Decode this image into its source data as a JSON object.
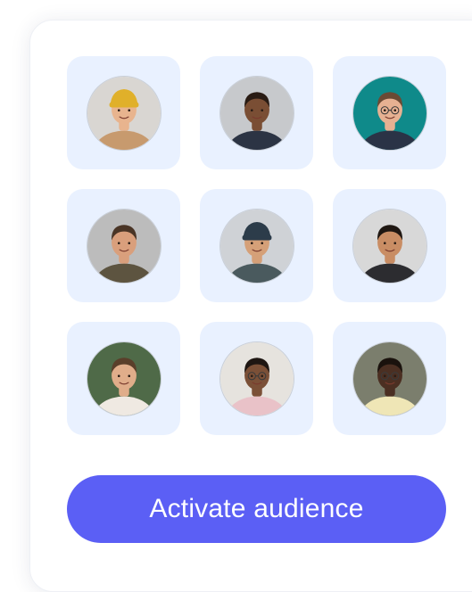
{
  "audience": {
    "people": [
      {
        "name": "person-1",
        "icon": "person-avatar",
        "bg": "#d9d6d2",
        "skin": "#e8b48e",
        "hair": "#e0b02a",
        "shirt": "#c79a6e",
        "hat": "beanie",
        "glasses": false
      },
      {
        "name": "person-2",
        "icon": "person-avatar",
        "bg": "#c7c9cc",
        "skin": "#7a4e34",
        "hair": "#2a1c14",
        "shirt": "#2c3444",
        "hat": "none",
        "glasses": false
      },
      {
        "name": "person-3",
        "icon": "person-avatar",
        "bg": "#0f8a8a",
        "skin": "#e6b192",
        "hair": "#6b4a34",
        "shirt": "#2a3346",
        "hat": "none",
        "glasses": true
      },
      {
        "name": "person-4",
        "icon": "person-avatar",
        "bg": "#bcbcbc",
        "skin": "#d99f7c",
        "hair": "#4a3526",
        "shirt": "#5d5440",
        "hat": "none",
        "glasses": false
      },
      {
        "name": "person-5",
        "icon": "person-avatar",
        "bg": "#cfd2d6",
        "skin": "#d5a078",
        "hair": "#2c3c4a",
        "shirt": "#4a5a5e",
        "hat": "beanie",
        "glasses": false
      },
      {
        "name": "person-6",
        "icon": "person-avatar",
        "bg": "#d8d8d8",
        "skin": "#c98d64",
        "hair": "#1f1712",
        "shirt": "#2c2c30",
        "hat": "none",
        "glasses": false
      },
      {
        "name": "person-7",
        "icon": "person-avatar",
        "bg": "#4f6a48",
        "skin": "#e0ad8a",
        "hair": "#5a3f2a",
        "shirt": "#efe9e2",
        "hat": "none",
        "glasses": false
      },
      {
        "name": "person-8",
        "icon": "person-avatar",
        "bg": "#e6e3de",
        "skin": "#7b5037",
        "hair": "#1e1612",
        "shirt": "#e9c2c8",
        "hat": "none",
        "glasses": true
      },
      {
        "name": "person-9",
        "icon": "person-avatar",
        "bg": "#7b7e6d",
        "skin": "#4b2f22",
        "hair": "#1a120d",
        "shirt": "#efe6b6",
        "hat": "none",
        "glasses": true
      }
    ]
  },
  "cta": {
    "label": "Activate audience",
    "color": "#5b5ff5"
  },
  "colors": {
    "tile": "#e9f1ff",
    "card": "#ffffff"
  }
}
